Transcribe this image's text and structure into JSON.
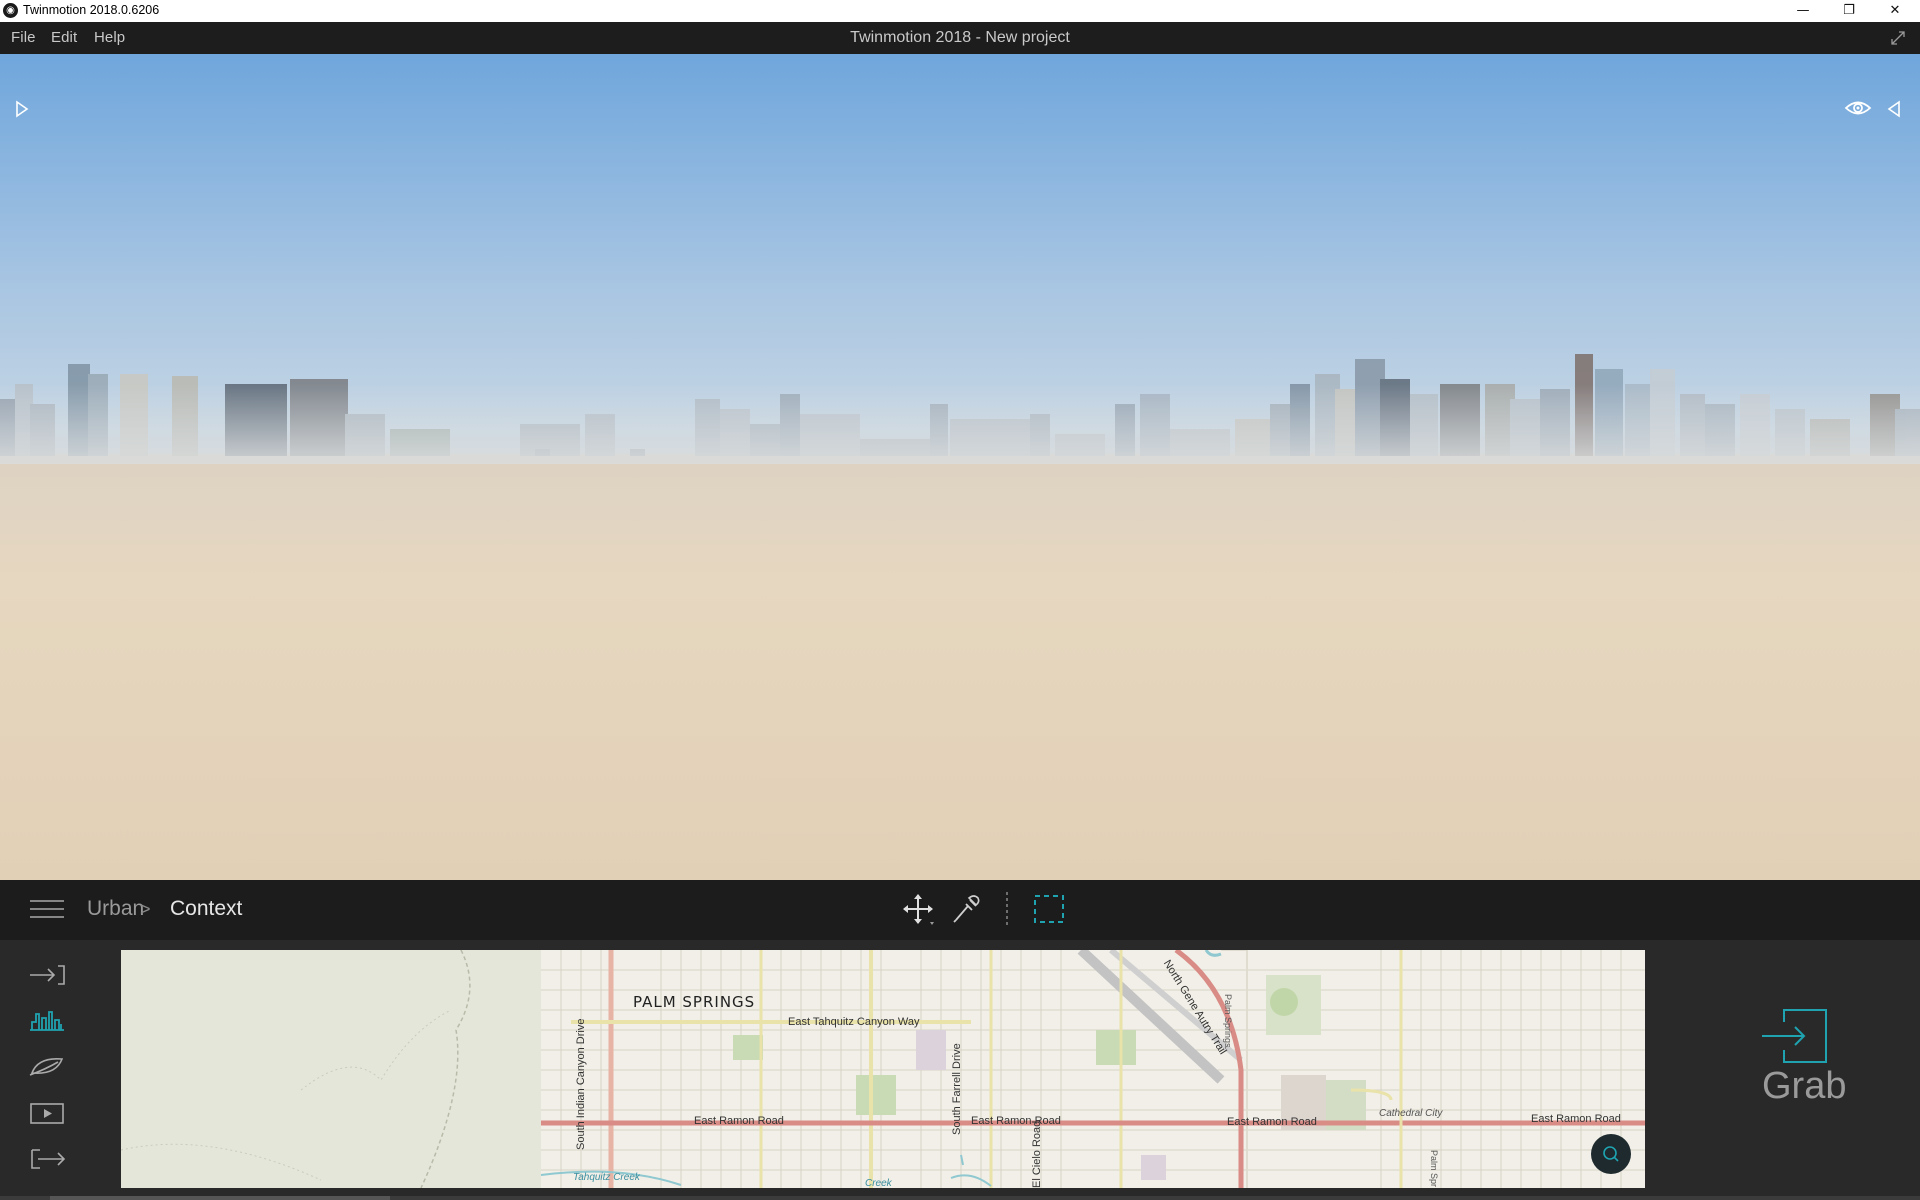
{
  "window": {
    "title": "Twinmotion 2018.0.6206",
    "app_icon": "twinmotion-logo",
    "minimize_glyph": "—",
    "restore_glyph": "❐",
    "close_glyph": "✕"
  },
  "menubar": {
    "items": [
      "File",
      "Edit",
      "Help"
    ],
    "project_title": "Twinmotion 2018 - New project"
  },
  "viewport": {
    "scene": "city-skyline-over-sand-plain",
    "sky_colors": [
      "#6fa6dc",
      "#bcd3e8"
    ],
    "ground_color": "#e3d3bb"
  },
  "toolbar": {
    "breadcrumb": [
      "Urban",
      "Context"
    ],
    "breadcrumb_separator": ">",
    "tools": [
      "move-icon",
      "eyedropper-icon",
      "selection-box-icon"
    ],
    "accent": "#1fa3b0"
  },
  "panel": {
    "side_tabs": [
      "import-icon",
      "context-icon",
      "leaf-icon",
      "media-icon",
      "export-icon"
    ],
    "active_tab": "context-icon",
    "grab_label": "Grab",
    "map": {
      "city": "PALM SPRINGS",
      "labels": {
        "tahquitz_way": "East Tahquitz Canyon Way",
        "indian_canyon": "South Indian Canyon Drive",
        "farrell": "South Farrell Drive",
        "ramon1": "East Ramon Road",
        "ramon2": "East Ramon Road",
        "ramon3": "East Ramon Road",
        "ramon4": "East Ramon Road",
        "gene_autry": "North Gene Autry Trail",
        "el_cielo": "El Cielo Road",
        "cathedral_city": "Cathedral City",
        "tahquitz_creek": "Tahquitz Creek",
        "palm_springs_small": "Palm Springs",
        "creek": "Creek",
        "palm_spr": "Palm Spr"
      }
    }
  }
}
